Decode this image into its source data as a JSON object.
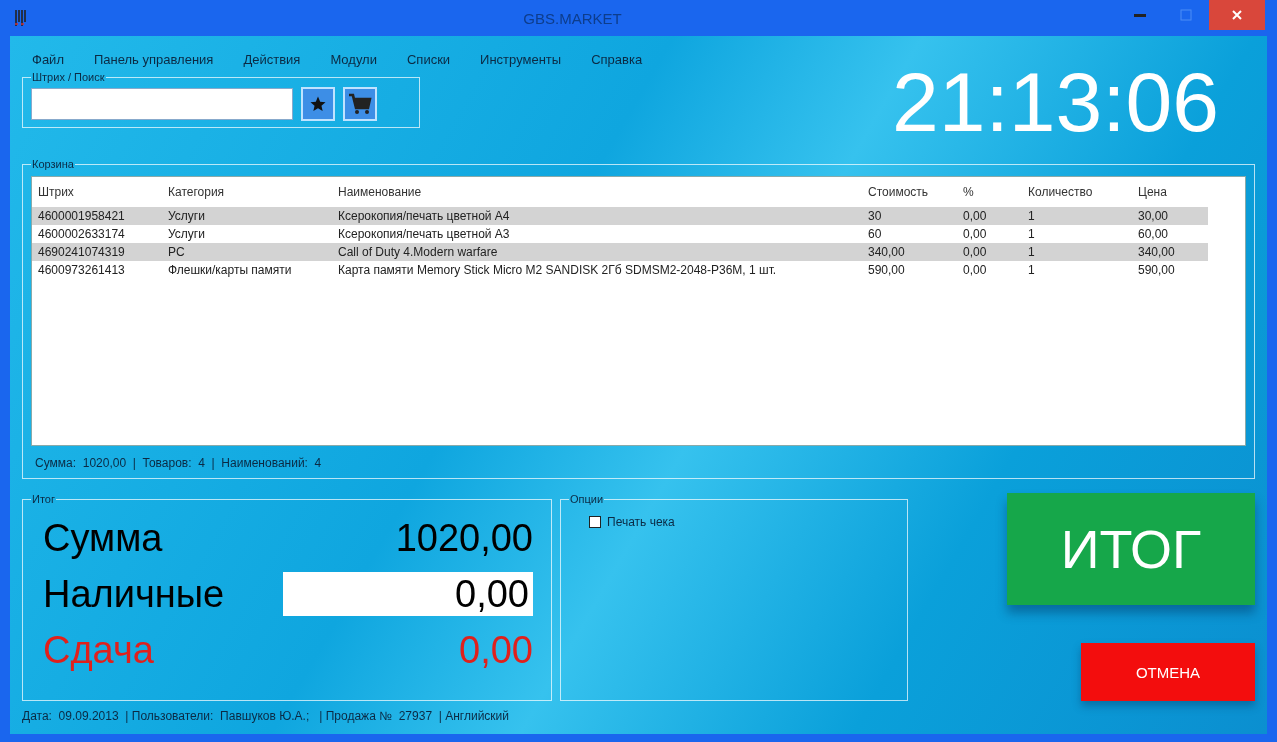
{
  "window": {
    "title": "GBS.MARKET"
  },
  "menu": [
    "Файл",
    "Панель управления",
    "Действия",
    "Модули",
    "Списки",
    "Инструменты",
    "Справка"
  ],
  "search": {
    "label": "Штрих / Поиск"
  },
  "clock": "21:13:06",
  "basket": {
    "label": "Корзина",
    "columns": [
      "Штрих",
      "Категория",
      "Наименование",
      "Стоимость",
      "%",
      "Количество",
      "Цена"
    ],
    "rows": [
      [
        "4600001958421",
        "Услуги",
        "Ксерокопия/печать цветной А4",
        "30",
        "0,00",
        "1",
        "30,00"
      ],
      [
        "4600002633174",
        "Услуги",
        "Ксерокопия/печать цветной А3",
        "60",
        "0,00",
        "1",
        "60,00"
      ],
      [
        "4690241074319",
        "PC",
        "Call of Duty 4.Modern warfare",
        "340,00",
        "0,00",
        "1",
        "340,00"
      ],
      [
        "4600973261413",
        "Флешки/карты памяти",
        "Карта памяти Memory Stick Micro M2 SANDISK 2Гб SDMSM2-2048-P36M, 1 шт.",
        "590,00",
        "0,00",
        "1",
        "590,00"
      ]
    ],
    "summary": "Сумма:  1020,00  |  Товаров:  4  |  Наименований:  4"
  },
  "total": {
    "label": "Итог",
    "rows": [
      {
        "kind": "text",
        "label": "Сумма",
        "value": "1020,00",
        "color": "#000000"
      },
      {
        "kind": "input",
        "label": "Наличные",
        "value": "0,00",
        "color": "#000000"
      },
      {
        "kind": "text",
        "label": "Сдача",
        "value": "0,00",
        "color": "#e0201c"
      }
    ]
  },
  "options": {
    "label": "Опции",
    "items": [
      {
        "label": "Печать чека",
        "checked": false
      }
    ]
  },
  "buttons": {
    "total": "ИТОГ",
    "cancel": "ОТМЕНА"
  },
  "status_bar": "Дата:  09.09.2013  | Пользователи:  Павшуков Ю.А.;   | Продажа №  27937  | Английский"
}
